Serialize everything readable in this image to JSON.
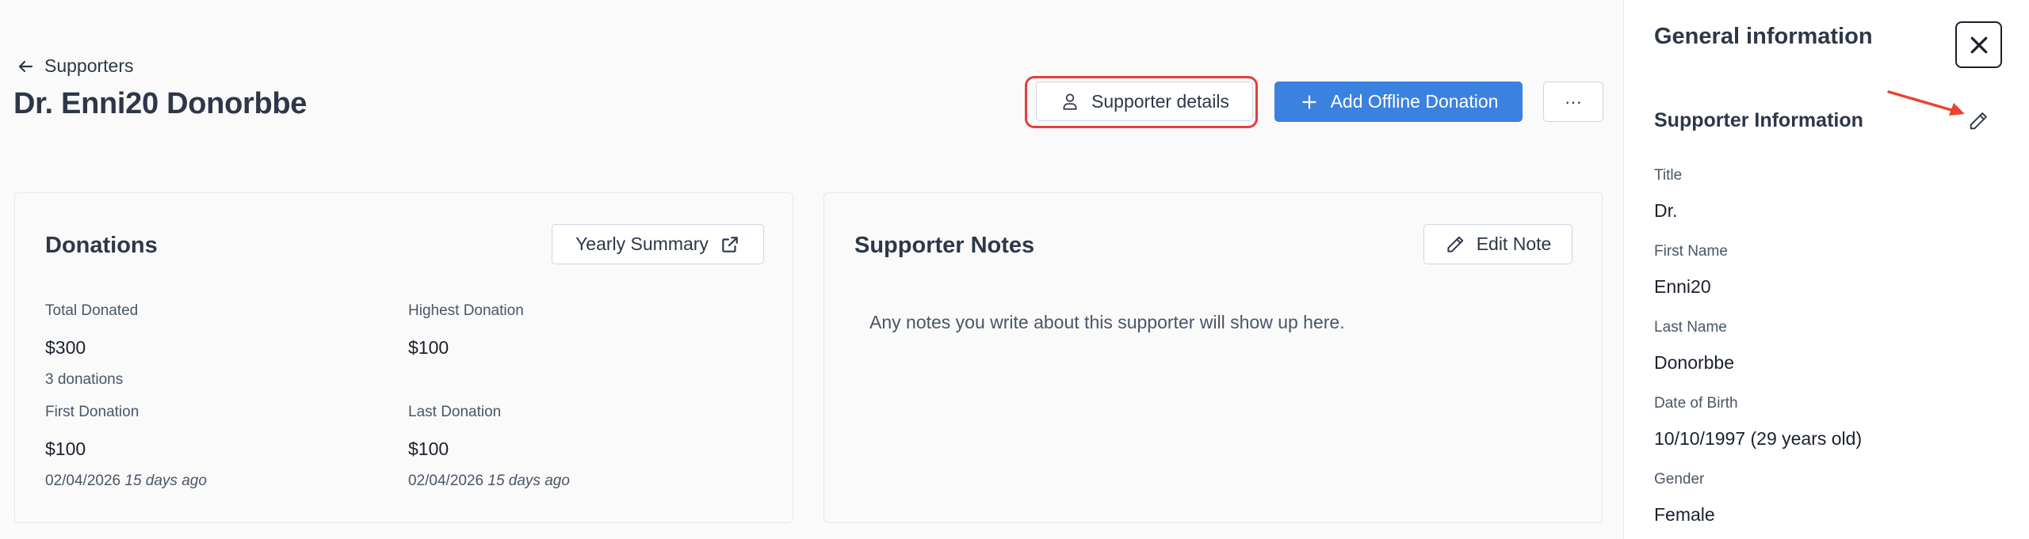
{
  "header": {
    "back_label": "Supporters",
    "title": "Dr. Enni20 Donorbbe",
    "supporter_details_label": "Supporter details",
    "add_donation_label": "Add Offline Donation",
    "more_label": "···"
  },
  "donations": {
    "title": "Donations",
    "yearly_summary_label": "Yearly Summary",
    "total_donated_label": "Total Donated",
    "total_donated_value": "$300",
    "total_donated_sub": "3 donations",
    "highest_label": "Highest Donation",
    "highest_value": "$100",
    "first_label": "First Donation",
    "first_value": "$100",
    "first_date": "02/04/2026",
    "first_ago": "15 days ago",
    "last_label": "Last Donation",
    "last_value": "$100",
    "last_date": "02/04/2026",
    "last_ago": "15 days ago"
  },
  "notes": {
    "title": "Supporter Notes",
    "edit_label": "Edit Note",
    "empty_text": "Any notes you write about this supporter will show up here."
  },
  "panel": {
    "title": "General information",
    "section_title": "Supporter Information",
    "fields": [
      {
        "label": "Title",
        "value": "Dr."
      },
      {
        "label": "First Name",
        "value": "Enni20"
      },
      {
        "label": "Last Name",
        "value": "Donorbbe"
      },
      {
        "label": "Date of Birth",
        "value": "10/10/1997 (29 years old)"
      },
      {
        "label": "Gender",
        "value": "Female"
      }
    ]
  },
  "colors": {
    "primary": "#3b82e0",
    "highlight": "#e53e3e",
    "annotation_arrow": "#e8442e"
  },
  "icons": [
    "arrow-left-icon",
    "user-icon",
    "plus-icon",
    "external-link-icon",
    "pencil-icon",
    "close-icon"
  ]
}
